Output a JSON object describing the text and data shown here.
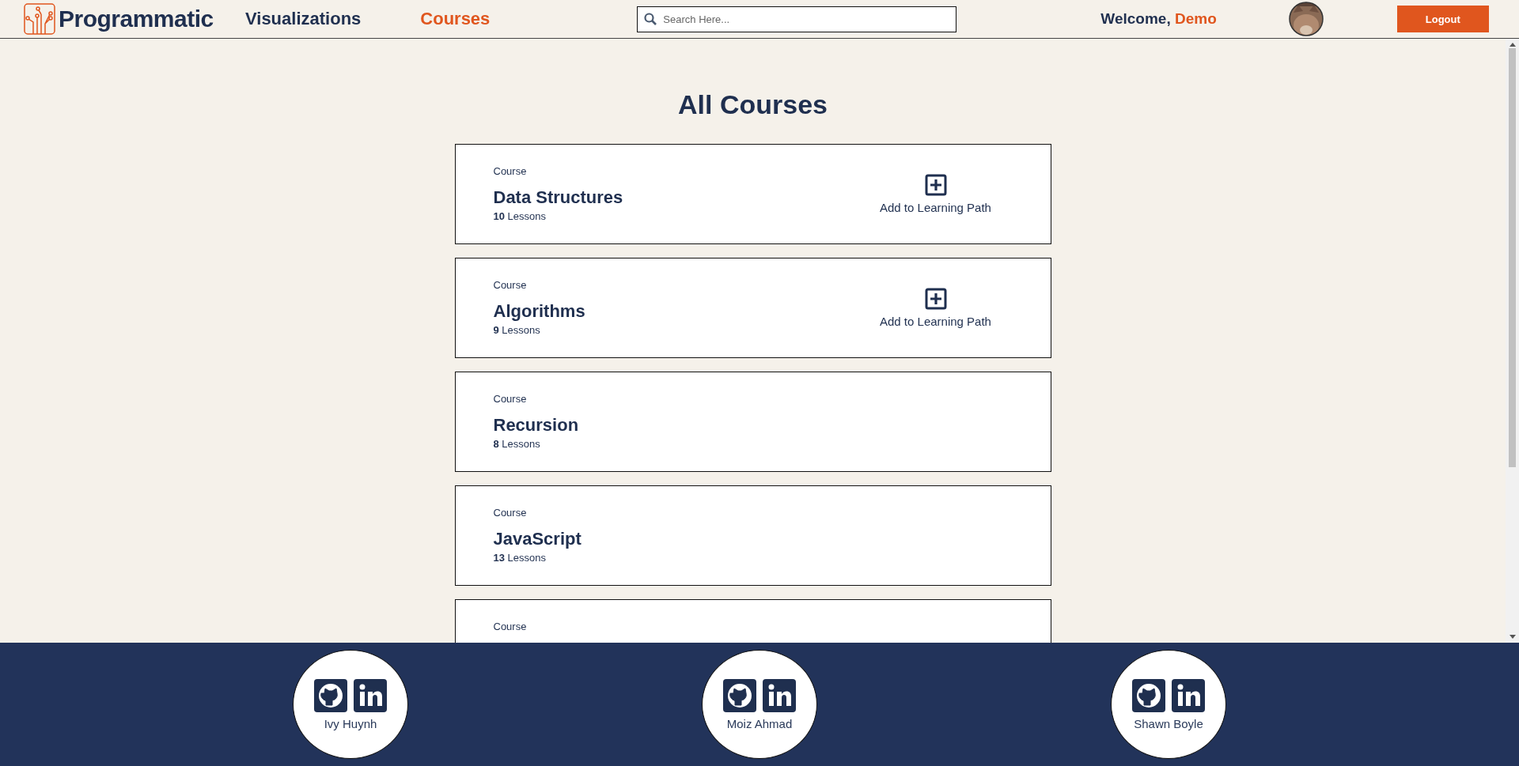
{
  "header": {
    "logo": "Programmatic",
    "nav": [
      {
        "label": "Visualizations",
        "selected": false
      },
      {
        "label": "Courses",
        "selected": true
      }
    ],
    "search": {
      "placeholder": "Search Here..."
    },
    "welcome": "Welcome,",
    "user": "Demo",
    "logout": "Logout"
  },
  "title": "All Courses",
  "courses": [
    {
      "kind_label": "Course",
      "name": "Data Structures",
      "count": "10",
      "unit": "Lessons",
      "addable": true,
      "add_label": "Add to Learning Path"
    },
    {
      "kind_label": "Course",
      "name": "Algorithms",
      "count": "9",
      "unit": "Lessons",
      "addable": true,
      "add_label": "Add to Learning Path"
    },
    {
      "kind_label": "Course",
      "name": "Recursion",
      "count": "8",
      "unit": "Lessons",
      "addable": false
    },
    {
      "kind_label": "Course",
      "name": "JavaScript",
      "count": "13",
      "unit": "Lessons",
      "addable": false
    },
    {
      "kind_label": "Course",
      "addable": false
    }
  ],
  "footer": {
    "members": [
      {
        "name": "Ivy Huynh"
      },
      {
        "name": "Moiz Ahmad"
      },
      {
        "name": "Shawn Boyle"
      }
    ]
  }
}
